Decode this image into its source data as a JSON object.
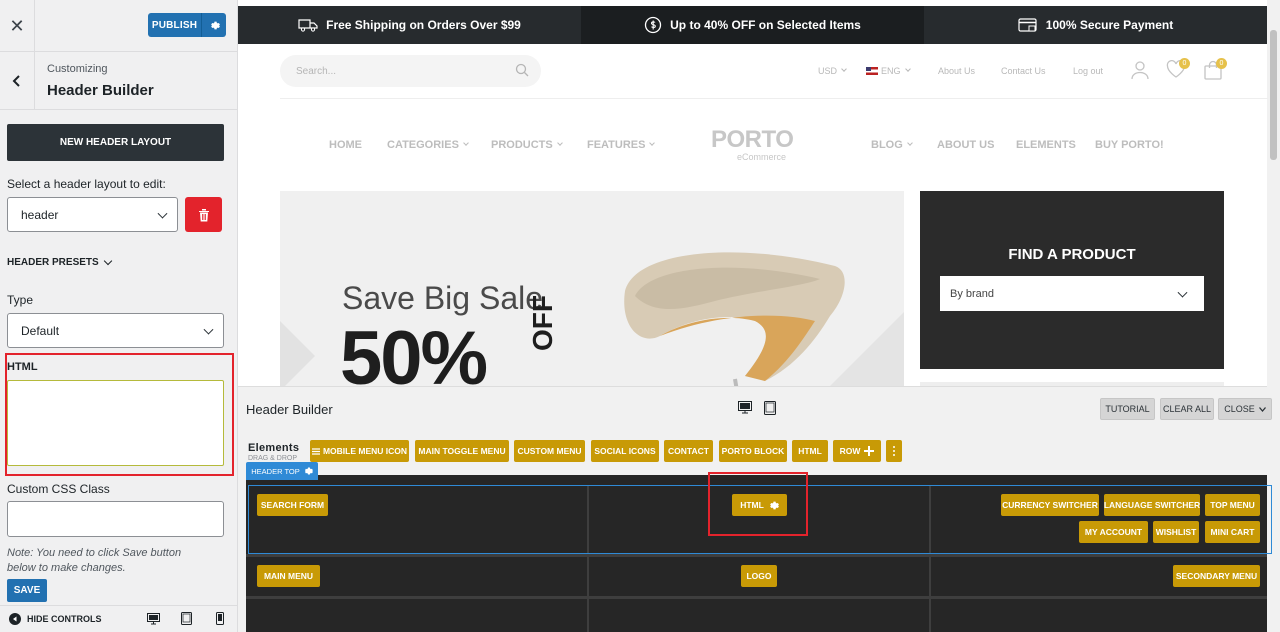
{
  "panel": {
    "close_glyph": "✕",
    "publish_label": "PUBLISH",
    "customizing_label": "Customizing",
    "section_title": "Header Builder",
    "new_layout_label": "NEW HEADER LAYOUT",
    "select_layout_label": "Select a header layout to edit:",
    "layout_value": "header",
    "presets_label": "HEADER PRESETS",
    "type_label": "Type",
    "type_value": "Default",
    "html_label": "HTML",
    "html_value": "",
    "css_label": "Custom CSS Class",
    "css_value": "",
    "note": "Note: You need to click Save button below to make changes.",
    "save_label": "SAVE",
    "hide_controls_label": "HIDE CONTROLS"
  },
  "preview": {
    "promos": [
      {
        "icon": "truck-icon",
        "text": "Free Shipping on Orders Over $99"
      },
      {
        "icon": "dollar-coin-icon",
        "text": "Up to 40% OFF on Selected Items"
      },
      {
        "icon": "secure-card-icon",
        "text": "100% Secure Payment"
      }
    ],
    "search_placeholder": "Search...",
    "currency": "USD",
    "language": "ENG",
    "top_links": [
      "About Us",
      "Contact Us",
      "Log out"
    ],
    "wishlist_count": "0",
    "cart_count": "0",
    "nav_left": [
      "HOME",
      "CATEGORIES",
      "PRODUCTS",
      "FEATURES"
    ],
    "nav_right": [
      "BLOG",
      "ABOUT US",
      "ELEMENTS",
      "BUY PORTO!"
    ],
    "logo_text": "PORTO",
    "logo_sub": "eCommerce",
    "banner_line1": "Save Big Sale",
    "banner_pct": "50%",
    "banner_off": "OFF",
    "find_title": "FIND A PRODUCT",
    "find_select": "By brand"
  },
  "builder": {
    "title": "Header Builder",
    "tutorial": "TUTORIAL",
    "clear_all": "CLEAR ALL",
    "close": "CLOSE",
    "elements_label": "Elements",
    "drag_label": "DRAG & DROP",
    "elements": [
      "MOBILE MENU ICON",
      "MAIN TOGGLE MENU",
      "CUSTOM MENU",
      "SOCIAL ICONS",
      "CONTACT",
      "PORTO BLOCK",
      "HTML",
      "ROW"
    ],
    "header_top_label": "HEADER TOP",
    "top_left": "SEARCH FORM",
    "top_center": "HTML",
    "top_right_row1": [
      "CURRENCY SWITCHER",
      "LANGUAGE SWITCHER",
      "TOP MENU"
    ],
    "top_right_row2": [
      "MY ACCOUNT",
      "WISHLIST",
      "MINI CART"
    ],
    "main_left": "MAIN MENU",
    "main_center": "LOGO",
    "main_right": "SECONDARY MENU"
  },
  "colors": {
    "accent": "#2271b1",
    "element_tag": "#c89a06",
    "highlight_red": "#e3232c",
    "builder_dark": "#262626"
  }
}
